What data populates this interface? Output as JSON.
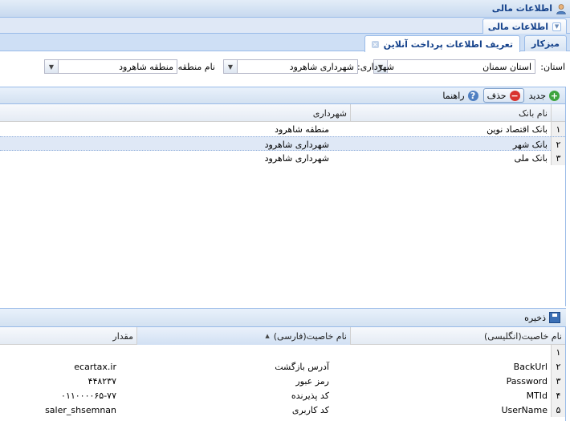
{
  "window": {
    "title": "اطلاعات مالی"
  },
  "panel": {
    "title": "اطلاعات مالی"
  },
  "tabs": [
    {
      "label": "میزکار",
      "active": false
    },
    {
      "label": "تعریف اطلاعات پرداخت آنلاین",
      "active": true,
      "closable": true
    }
  ],
  "filters": {
    "province": {
      "label": "استان:",
      "value": "استان سمنان"
    },
    "municipality": {
      "label": "شهرداری:",
      "value": "شهرداری شاهرود"
    },
    "region": {
      "label": "نام منطقه:",
      "value": "منطقه شاهرود"
    }
  },
  "grid1": {
    "toolbar": {
      "new_label": "جدید",
      "delete_label": "حذف",
      "help_label": "راهنما"
    },
    "columns": [
      "نام بانک",
      "شهرداری"
    ],
    "rows": [
      {
        "num": "۱",
        "bank": "بانک اقتصاد نوین",
        "municipality": "منطقه شاهرود",
        "selected": false
      },
      {
        "num": "۲",
        "bank": "بانک شهر",
        "municipality": "شهرداری شاهرود",
        "selected": true
      },
      {
        "num": "۳",
        "bank": "بانک ملی",
        "municipality": "شهرداری شاهرود",
        "selected": false
      }
    ]
  },
  "grid2": {
    "toolbar": {
      "save_label": "ذخیره"
    },
    "columns": [
      "نام خاصیت(انگلیسی)",
      "نام خاصیت(فارسی)",
      "مقدار"
    ],
    "sort_indicator": "▲",
    "rows": [
      {
        "num": "۱",
        "en": "",
        "fa": "",
        "value": ""
      },
      {
        "num": "۲",
        "en": "BackUrl",
        "fa": "آدرس بازگشت",
        "value": "ecartax.ir"
      },
      {
        "num": "۳",
        "en": "Password",
        "fa": "رمز عبور",
        "value": "۴۴۸۲۳۷"
      },
      {
        "num": "۴",
        "en": "MTId",
        "fa": "کد پذیرنده",
        "value": "۰۱۱۰۰۰۰۶۵-۷۷"
      },
      {
        "num": "۵",
        "en": "UserName",
        "fa": "کد کاربری",
        "value": "saler_shsemnan"
      }
    ]
  }
}
